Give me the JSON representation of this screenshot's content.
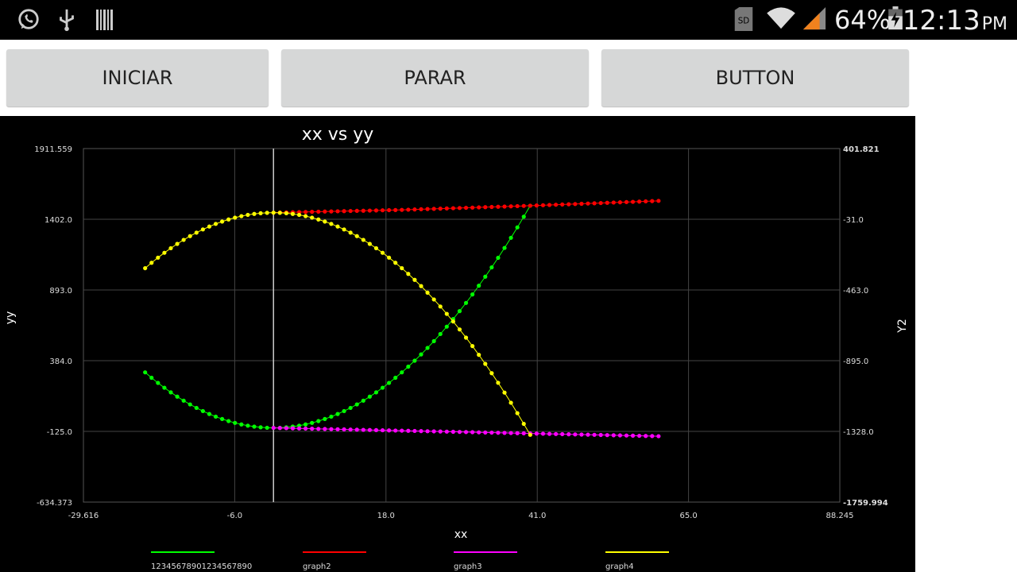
{
  "status_bar": {
    "time": "12:13",
    "ampm": "PM",
    "battery_percent": "64%",
    "icons": [
      "whatsapp-icon",
      "usb-icon",
      "barcode-icon",
      "sd-card-icon",
      "wifi-icon",
      "signal-icon",
      "battery-charging-icon"
    ],
    "sd_label": "SD"
  },
  "buttons": {
    "iniciar": "INICIAR",
    "parar": "PARAR",
    "button": "BUTTON"
  },
  "chart_data": {
    "type": "line",
    "title": "xx vs yy",
    "xlabel": "xx",
    "ylabel": "yy",
    "y2label": "Y2",
    "xlim": [
      -29.616,
      88.245
    ],
    "ylim": [
      -634.373,
      1911.559
    ],
    "y2lim": [
      -1759.994,
      401.821
    ],
    "x_ticks": [
      "-29.616",
      "-6.0",
      "18.0",
      "41.0",
      "65.0",
      "88.245"
    ],
    "y_ticks": [
      "1911.559",
      "1402.0",
      "893.0",
      "384.0",
      "-125.0",
      "-634.373"
    ],
    "y2_ticks": [
      "401.821",
      "-31.0",
      "-463.0",
      "-895.0",
      "-1328.0",
      "-1759.994"
    ],
    "grid": true,
    "vertical_marker_x": 0,
    "legend_position": "bottom",
    "colors": {
      "graph1": "#00ff00",
      "graph2": "#ff0000",
      "graph3": "#ff00ff",
      "graph4": "#ffff00",
      "grid": "#444444",
      "marker": "#cccccc"
    },
    "series": [
      {
        "name": "12345678901234567890",
        "axis": "y",
        "x_range": [
          -20,
          40
        ],
        "points": 61,
        "formula": "y = x^2 - 100",
        "x": [
          -20,
          -10,
          0,
          10,
          20,
          30,
          40
        ],
        "values": [
          300,
          0,
          -100,
          0,
          300,
          800,
          1500
        ]
      },
      {
        "name": "graph2",
        "axis": "y",
        "x_range": [
          0,
          60
        ],
        "points": 61,
        "x": [
          0,
          20,
          40,
          60
        ],
        "values": [
          1450,
          1470,
          1500,
          1535
        ]
      },
      {
        "name": "graph3",
        "axis": "y",
        "x_range": [
          0,
          60
        ],
        "points": 61,
        "x": [
          0,
          20,
          40,
          60
        ],
        "values": [
          -100,
          -120,
          -140,
          -160
        ]
      },
      {
        "name": "graph4",
        "axis": "y",
        "x_range": [
          -20,
          40
        ],
        "points": 61,
        "formula": "y = 1450 - x^2",
        "x": [
          -20,
          -10,
          0,
          10,
          20,
          30,
          40
        ],
        "values": [
          1050,
          1350,
          1450,
          1350,
          1050,
          550,
          -150
        ]
      }
    ]
  }
}
